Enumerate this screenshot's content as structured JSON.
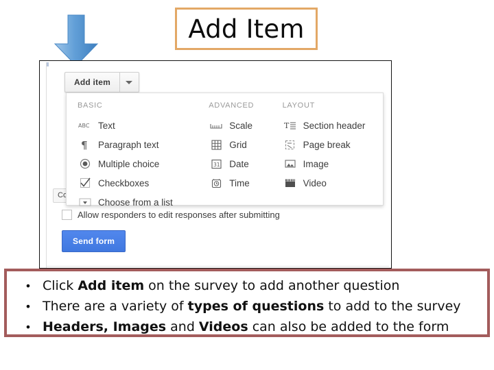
{
  "slide": {
    "title": "Add Item",
    "title_border_color": "#E3A866",
    "bullet_box_border_color": "#A35C5C",
    "arrow_color": "#5B9BD5"
  },
  "screenshot": {
    "toolbar": {
      "add_item_label": "Add item",
      "caret_icon": "chevron-down-icon"
    },
    "confirmation_chip": "Co",
    "menu": {
      "columns": [
        {
          "heading": "BASIC",
          "items": [
            {
              "icon": "abc-text-icon",
              "label": "Text"
            },
            {
              "icon": "pilcrow-icon",
              "label": "Paragraph text"
            },
            {
              "icon": "radio-button-icon",
              "label": "Multiple choice"
            },
            {
              "icon": "checkbox-check-icon",
              "label": "Checkboxes"
            },
            {
              "icon": "dropdown-list-icon",
              "label": "Choose from a list"
            }
          ]
        },
        {
          "heading": "ADVANCED",
          "items": [
            {
              "icon": "ruler-scale-icon",
              "label": "Scale"
            },
            {
              "icon": "grid-icon",
              "label": "Grid"
            },
            {
              "icon": "calendar-31-icon",
              "label": "Date"
            },
            {
              "icon": "clock-icon",
              "label": "Time"
            }
          ]
        },
        {
          "heading": "LAYOUT",
          "items": [
            {
              "icon": "section-header-icon",
              "label": "Section header"
            },
            {
              "icon": "page-break-icon",
              "label": "Page break"
            },
            {
              "icon": "image-icon",
              "label": "Image"
            },
            {
              "icon": "video-clapper-icon",
              "label": "Video"
            }
          ]
        }
      ]
    },
    "allow_edit_label": "Allow responders to edit responses after submitting",
    "send_form_label": "Send form"
  },
  "bullets": [
    {
      "marker": "•",
      "parts": [
        {
          "text": "Click ",
          "bold": false
        },
        {
          "text": "Add item",
          "bold": true
        },
        {
          "text": " on the survey to add another question",
          "bold": false
        }
      ]
    },
    {
      "marker": "•",
      "parts": [
        {
          "text": "There are a variety of ",
          "bold": false
        },
        {
          "text": "types of questions",
          "bold": true
        },
        {
          "text": " to add to the survey",
          "bold": false
        }
      ]
    },
    {
      "marker": "•",
      "parts": [
        {
          "text": "",
          "bold": false
        },
        {
          "text": "Headers, Images",
          "bold": true
        },
        {
          "text": " and ",
          "bold": false
        },
        {
          "text": "Videos",
          "bold": true
        },
        {
          "text": " can also be added to the form",
          "bold": false
        }
      ]
    }
  ]
}
